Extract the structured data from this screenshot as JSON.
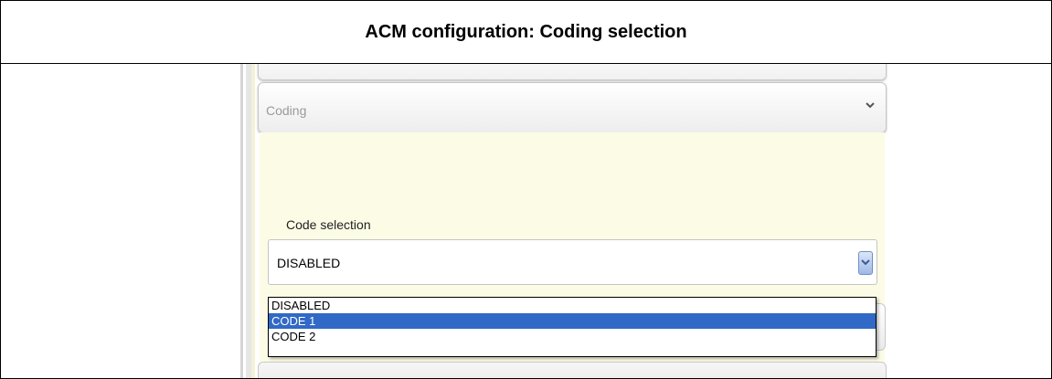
{
  "title": "ACM configuration: Coding selection",
  "panel": {
    "header_label": "Coding",
    "header_icon": "chevron-down-icon"
  },
  "code_selection": {
    "label": "Code selection",
    "value": "DISABLED",
    "options": [
      "DISABLED",
      "CODE 1",
      "CODE 2"
    ],
    "highlighted_option": "CODE 1"
  },
  "colors": {
    "content_background": "#fcfce6",
    "highlight": "#3169c6"
  }
}
